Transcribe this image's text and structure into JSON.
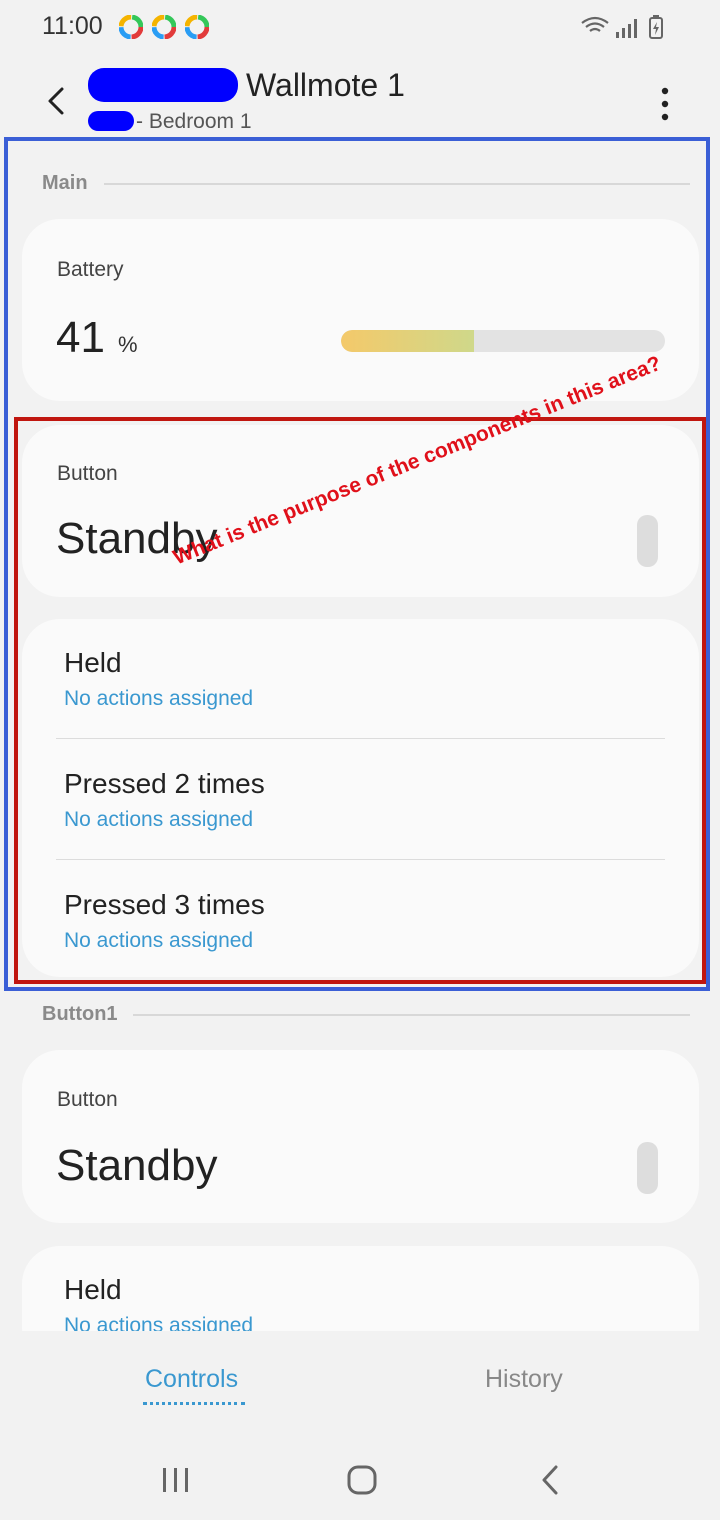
{
  "status_bar": {
    "time": "11:00"
  },
  "header": {
    "title_suffix": "Wallmote 1",
    "subtitle": "- Bedroom 1"
  },
  "main_section": {
    "label": "Main",
    "battery": {
      "label": "Battery",
      "value": "41",
      "unit": "%",
      "level_percent": 41
    },
    "button": {
      "label": "Button",
      "state": "Standby"
    },
    "actions": [
      {
        "title": "Held",
        "subtitle": "No actions assigned"
      },
      {
        "title": "Pressed 2 times",
        "subtitle": "No actions assigned"
      },
      {
        "title": "Pressed 3 times",
        "subtitle": "No actions assigned"
      }
    ]
  },
  "button1_section": {
    "label": "Button1",
    "button": {
      "label": "Button",
      "state": "Standby"
    },
    "actions": [
      {
        "title": "Held",
        "subtitle": "No actions assigned"
      }
    ]
  },
  "annotation": {
    "note": "What is the purpose of the components in this area?"
  },
  "tabs": {
    "controls": "Controls",
    "history": "History"
  },
  "colors": {
    "accent": "#3a98d0",
    "annotation_blue": "#3b5fd6",
    "annotation_red": "#c0160f"
  }
}
